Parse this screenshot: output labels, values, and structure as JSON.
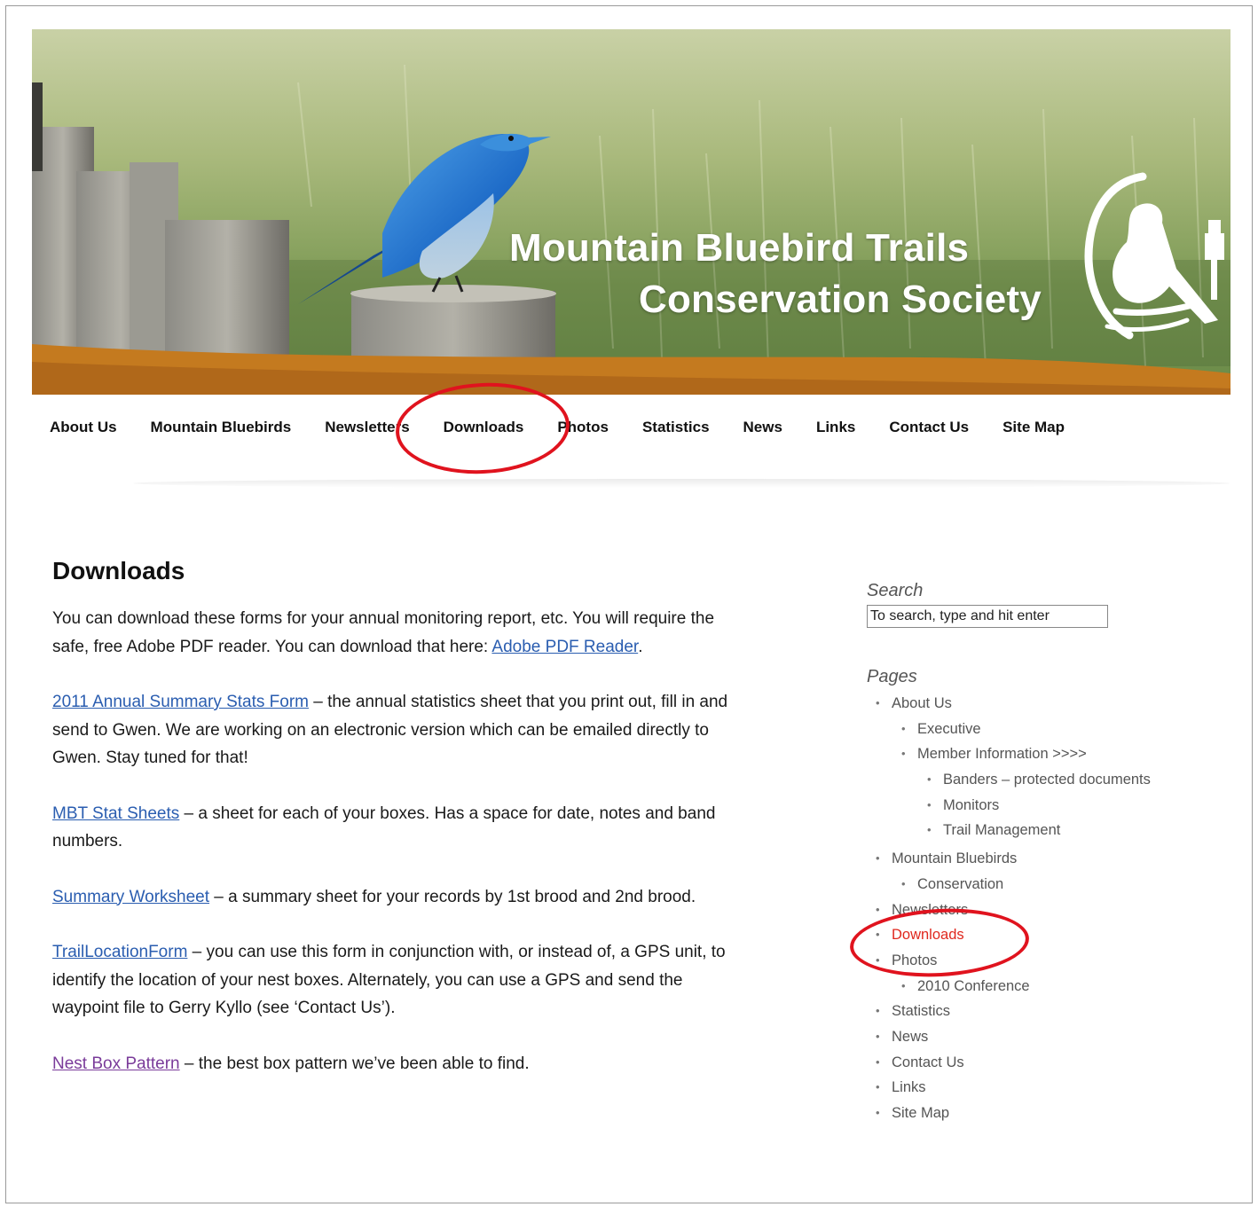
{
  "site": {
    "title_line1": "Mountain Bluebird Trails",
    "title_line2": "Conservation Society"
  },
  "nav": {
    "items": [
      {
        "label": "About Us"
      },
      {
        "label": "Mountain Bluebirds"
      },
      {
        "label": "Newsletters"
      },
      {
        "label": "Downloads"
      },
      {
        "label": "Photos"
      },
      {
        "label": "Statistics"
      },
      {
        "label": "News"
      },
      {
        "label": "Links"
      },
      {
        "label": "Contact Us"
      },
      {
        "label": "Site Map"
      }
    ]
  },
  "main": {
    "title": "Downloads",
    "intro_text": "You can download these forms for your annual monitoring report, etc. You will require the safe, free Adobe PDF reader. You can download that here: ",
    "intro_link": "Adobe PDF Reader",
    "intro_end": ".",
    "entries": [
      {
        "link": "2011 Annual Summary Stats Form",
        "text": " – the annual statistics sheet that you print out, fill in and send to Gwen. We are working on an electronic version which can be emailed directly to Gwen. Stay tuned for that!"
      },
      {
        "link": "MBT Stat Sheets",
        "text": " – a sheet for each of your boxes. Has a space for date, notes and band numbers."
      },
      {
        "link": "Summary Worksheet",
        "text": " – a summary sheet for your records by 1st brood and 2nd brood."
      },
      {
        "link": "TrailLocationForm",
        "text": " – you can use this form in conjunction with, or instead of, a GPS unit, to identify the location of your nest boxes. Alternately, you can use a GPS and send the waypoint file to Gerry Kyllo (see ‘Contact Us’)."
      },
      {
        "link": "Nest Box Pattern",
        "text": " – the best box pattern we’ve been able to find."
      }
    ]
  },
  "sidebar": {
    "search_title": "Search",
    "search_value": "To search, type and hit enter",
    "pages_title": "Pages",
    "pages": {
      "about": "About Us",
      "executive": "Executive",
      "member_info": "Member Information >>>>",
      "banders": "Banders – protected documents",
      "monitors": "Monitors",
      "trail_mgmt": "Trail Management",
      "mountain_bluebirds": "Mountain Bluebirds",
      "conservation": "Conservation",
      "newsletters": "Newsletters",
      "downloads": "Downloads",
      "photos": "Photos",
      "conference": "2010 Conference",
      "statistics": "Statistics",
      "news": "News",
      "contact": "Contact Us",
      "links": "Links",
      "site_map": "Site Map"
    }
  },
  "colors": {
    "accent_orange": "#c47a1f",
    "annotation_red": "#e0131e",
    "current_page_red": "#e0281e",
    "link_blue": "#2a5db0",
    "link_visited": "#7a3b9a"
  }
}
